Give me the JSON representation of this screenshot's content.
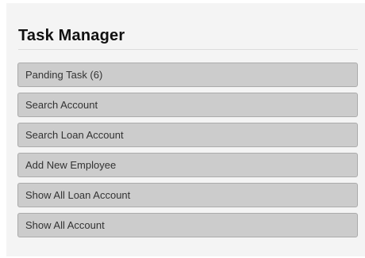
{
  "panel": {
    "title": "Task Manager"
  },
  "menu": {
    "items": [
      {
        "label": "Panding Task (6)"
      },
      {
        "label": "Search Account"
      },
      {
        "label": "Search Loan Account"
      },
      {
        "label": "Add New Employee"
      },
      {
        "label": "Show All Loan Account"
      },
      {
        "label": "Show All Account"
      }
    ]
  },
  "colors": {
    "panel_background": "#f4f4f4",
    "item_background": "#cccccc",
    "item_border": "#ababab",
    "title_text": "#111111",
    "item_text": "#333333"
  }
}
